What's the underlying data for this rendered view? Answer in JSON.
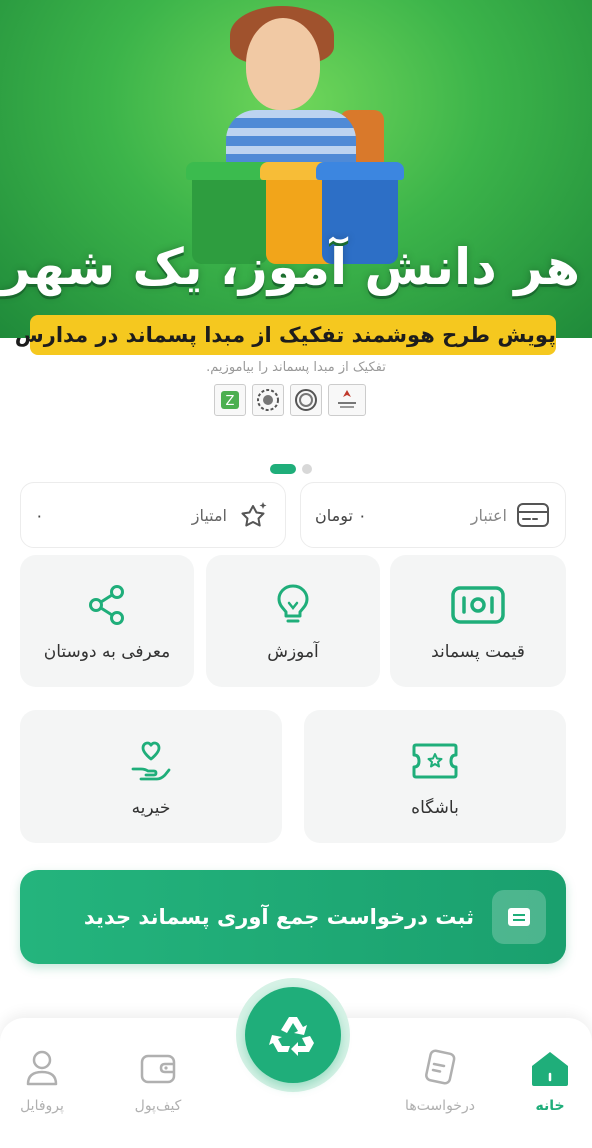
{
  "banner": {
    "headline": "هر دانش آموز، یک شهر یار",
    "pill_text": "پویش طرح هوشمند تفکیک از مبدا پسماند در مدارس",
    "subtitle": "تفکیک از مبدا پسماند را بیاموزیم."
  },
  "carousel": {
    "count": 2,
    "active_index": 0
  },
  "stats": {
    "credit_label": "اعتبار",
    "credit_value": "۰ تومان",
    "points_label": "امتیاز",
    "points_value": "۰"
  },
  "tiles": {
    "waste_price": "قیمت پسماند",
    "education": "آموزش",
    "invite_friends": "معرفی به دوستان",
    "club": "باشگاه",
    "charity": "خیریه"
  },
  "cta": {
    "label": "ثبت درخواست جمع آوری پسماند جدید"
  },
  "nav": {
    "home": "خانه",
    "requests": "درخواست‌ها",
    "wallet": "کیف‌پول",
    "profile": "پروفایل"
  },
  "colors": {
    "accent": "#1fae7a",
    "banner_green": "#3cb44a",
    "pill_yellow": "#f5c81f"
  }
}
